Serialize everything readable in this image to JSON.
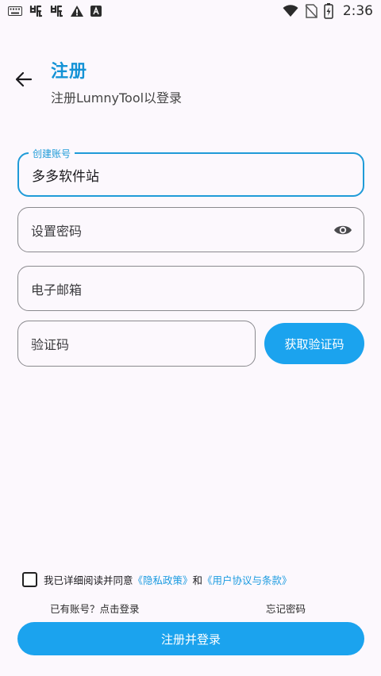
{
  "status_bar": {
    "time": "2:36",
    "icons": [
      "keyboard-icon",
      "bug-icon",
      "bug-icon",
      "warning-icon",
      "a-icon",
      "wifi-icon",
      "no-sim-icon",
      "battery-charging-icon"
    ]
  },
  "header": {
    "title": "注册",
    "subtitle": "注册LumnyTool以登录"
  },
  "form": {
    "account": {
      "label": "创建账号",
      "value": "多多软件站"
    },
    "password": {
      "placeholder": "设置密码"
    },
    "email": {
      "placeholder": "电子邮箱"
    },
    "code": {
      "placeholder": "验证码",
      "button_label": "获取验证码"
    }
  },
  "agreement": {
    "prefix": "我已详细阅读并同意",
    "privacy_link": "《隐私政策》",
    "and": "和",
    "terms_link": "《用户协议与条款》"
  },
  "links": {
    "have_account": "已有账号？点击登录",
    "forgot_password": "忘记密码"
  },
  "submit_label": "注册并登录",
  "colors": {
    "accent": "#1ba3ee",
    "title": "#1593d6",
    "background": "#fcf8fd"
  }
}
